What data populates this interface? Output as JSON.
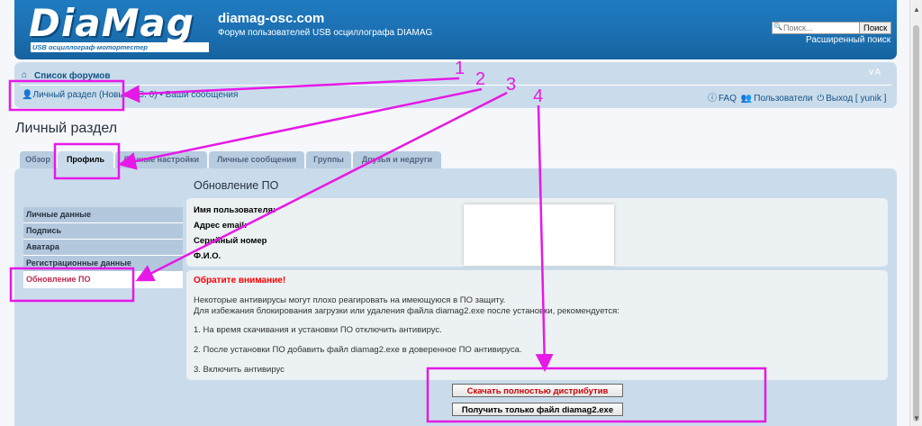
{
  "header": {
    "logo": "DiaMag",
    "logo_tagline": "USB осциллограф-мотортестер",
    "site_title": "diamag-osc.com",
    "site_description": "Форум пользователей USB осциллографа DIAMAG",
    "search_placeholder": "Поиск...",
    "search_button": "Поиск",
    "advanced_search": "Расширенный поиск"
  },
  "navbar": {
    "forum_index": "Список форумов",
    "personal_section": "Личный раздел (Новых ЛС: 0) • Ваши сообщения",
    "faq": "FAQ",
    "users": "Пользователи",
    "logout": "Выход [ yunik ]",
    "collapse": "∨A"
  },
  "page": {
    "heading": "Личный раздел",
    "tabs": [
      "Обзор",
      "Профиль",
      "Личные настройки",
      "Личные сообщения",
      "Группы",
      "Друзья и недруги"
    ],
    "active_tab": "Профиль",
    "sidemenu": [
      "Личные данные",
      "Подпись",
      "Аватара",
      "Регистрационные данные",
      "Обновление ПО"
    ],
    "active_sidemenu": "Обновление ПО",
    "section_title": "Обновление ПО",
    "info_labels": [
      "Имя пользователя:",
      "Адрес email:",
      "Серийный номер",
      "Ф.И.О."
    ],
    "warning_title": "Обратите внимание!",
    "warning_lines": [
      "Некоторые антивирусы могут плохо реагировать на имеющуюся в ПО защиту.",
      "Для избежания блокирования загрузки или удаления файла diamag2.exe после установки, рекомендуется:",
      "1. На время скачивания и установки ПО отключить антивирус.",
      "2. После установки ПО добавить файл diamag2.exe в доверенное ПО антивируса.",
      "3. Включить антивирус"
    ],
    "download_full_button": "Скачать полностью дистрибутив",
    "download_exe_button": "Получить только файл diamag2.exe"
  },
  "annotations": {
    "numbers": [
      "1",
      "2",
      "3",
      "4"
    ],
    "color": "#e619e6"
  },
  "colors": {
    "header_blue": "#1b6fb0",
    "nav_bg": "#cadceb",
    "link": "#105289",
    "warning_red": "#ff0000"
  }
}
